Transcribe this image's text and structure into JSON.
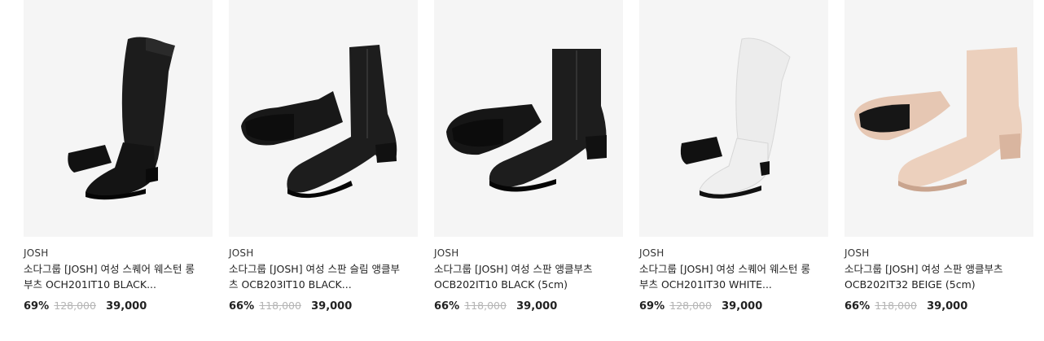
{
  "products": [
    {
      "brand": "JOSH",
      "name": "소다그룹 [JOSH] 여성 스퀘어 웨스턴 롱부츠 OCH201IT10 BLACK...",
      "discount": "69%",
      "original_price": "128,000",
      "sale_price": "39,000",
      "image": "black-western-long-boot"
    },
    {
      "brand": "JOSH",
      "name": "소다그룹 [JOSH] 여성 스판 슬림 앵클부츠 OCB203IT10 BLACK...",
      "discount": "66%",
      "original_price": "118,000",
      "sale_price": "39,000",
      "image": "black-slim-ankle-boot"
    },
    {
      "brand": "JOSH",
      "name": "소다그룹 [JOSH] 여성 스판 앵클부츠 OCB202IT10 BLACK (5cm)",
      "discount": "66%",
      "original_price": "118,000",
      "sale_price": "39,000",
      "image": "black-ankle-boot"
    },
    {
      "brand": "JOSH",
      "name": "소다그룹 [JOSH] 여성 스퀘어 웨스턴 롱부츠 OCH201IT30 WHITE...",
      "discount": "69%",
      "original_price": "128,000",
      "sale_price": "39,000",
      "image": "white-western-long-boot"
    },
    {
      "brand": "JOSH",
      "name": "소다그룹 [JOSH] 여성 스판 앵클부츠 OCB202IT32 BEIGE (5cm)",
      "discount": "66%",
      "original_price": "118,000",
      "sale_price": "39,000",
      "image": "beige-ankle-boot"
    }
  ],
  "colors": {
    "black_boot": "#1a1a1a",
    "white_boot": "#ececec",
    "beige_boot": "#e8cbb8",
    "image_bg": "#f5f5f5",
    "strike": "#b5b5b5"
  }
}
